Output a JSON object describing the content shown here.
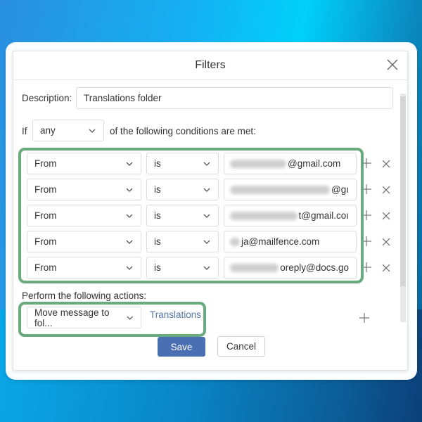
{
  "dialog": {
    "title": "Filters",
    "close_icon": "close-icon"
  },
  "description": {
    "label": "Description:",
    "value": "Translations folder"
  },
  "match": {
    "prefix": "If",
    "selected": "any",
    "suffix": "of the following conditions are met:"
  },
  "conditions": [
    {
      "field": "From",
      "operator": "is",
      "value_visible": "@gmail.com",
      "value_redacted": true
    },
    {
      "field": "From",
      "operator": "is",
      "value_visible": "@gı",
      "value_redacted": true
    },
    {
      "field": "From",
      "operator": "is",
      "value_visible": "t@gmail.coı",
      "value_redacted": true
    },
    {
      "field": "From",
      "operator": "is",
      "value_visible": "ja@mailfence.com",
      "value_redacted": true
    },
    {
      "field": "From",
      "operator": "is",
      "value_visible": "oreply@docs.go",
      "value_redacted": true
    }
  ],
  "actions": {
    "label": "Perform the following actions:",
    "items": [
      {
        "action": "Move message to fol...",
        "target": "Translations"
      }
    ]
  },
  "buttons": {
    "save": "Save",
    "cancel": "Cancel"
  },
  "colors": {
    "highlight": "#6aab7d",
    "primary": "#4a6fb3",
    "link": "#5478a8"
  }
}
